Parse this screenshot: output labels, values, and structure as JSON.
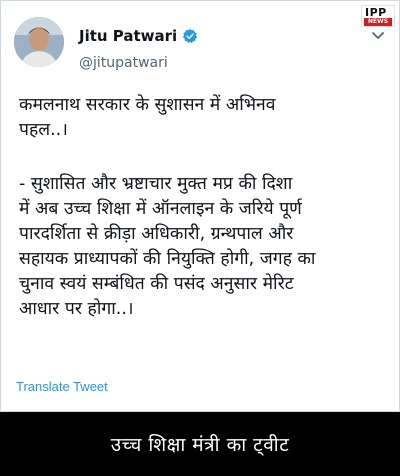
{
  "logo": {
    "brand": "IPP",
    "sub": "NEWS"
  },
  "tweet": {
    "author_name": "Jitu Patwari",
    "handle": "@jitupatwari",
    "verified_icon": "verified-badge-icon",
    "paragraph_1": "कमलनाथ सरकार के सुशासन में अभिनव\nपहल..।",
    "paragraph_2": "- सुशासित और भ्रष्टाचार मुक्त मप्र की दिशा\nमें अब उच्च शिक्षा में ऑनलाइन के जरिये पूर्ण\nपारदर्शिता से क्रीड़ा अधिकारी, ग्रन्थपाल और\nसहायक प्राध्यापकों की नियुक्ति होगी, जगह का\nचुनाव स्वयं सम्बंधित की पसंद अनुसार मेरिट\nआधार पर होगा..।",
    "translate_label": "Translate Tweet"
  },
  "caption": "उच्च शिक्षा मंत्री का ट्वीट",
  "colors": {
    "link": "#1d9bf0",
    "verified": "#1d9bf0",
    "logo_red": "#d31d1d",
    "caption_bg": "#000000"
  }
}
